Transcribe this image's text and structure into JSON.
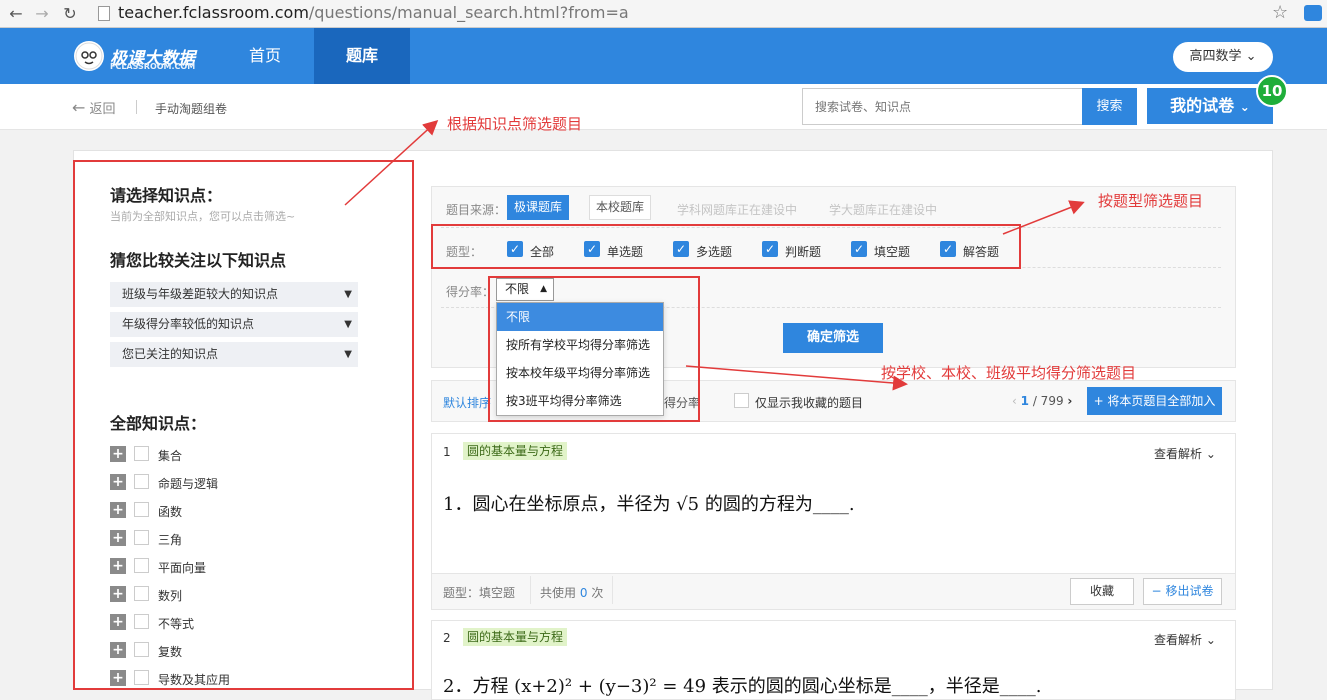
{
  "browser": {
    "url_host": "teacher.fclassroom.com",
    "url_path": "/questions/manual_search.html?from=a"
  },
  "header": {
    "logo_text": "极课大数据",
    "logo_sub": "FCLASSROOM.COM",
    "nav": [
      "首页",
      "题库"
    ],
    "subject": "高四数学"
  },
  "subbar": {
    "back": "返回",
    "crumb": "手动淘题组卷",
    "search_placeholder": "搜索试卷、知识点",
    "search_btn": "搜索",
    "paper_btn": "我的试卷",
    "paper_count": "10"
  },
  "left": {
    "title": "请选择知识点：",
    "hint": "当前为全部知识点，您可以点击筛选~",
    "guess_title": "猜您比较关注以下知识点",
    "selects": [
      "班级与年级差距较大的知识点",
      "年级得分率较低的知识点",
      "您已关注的知识点"
    ],
    "all_title": "全部知识点：",
    "tree": [
      "集合",
      "命题与逻辑",
      "函数",
      "三角",
      "平面向量",
      "数列",
      "不等式",
      "复数",
      "导数及其应用"
    ]
  },
  "filter": {
    "source_label": "题目来源：",
    "sources": [
      "极课题库",
      "本校题库"
    ],
    "sources_building": [
      "学科网题库正在建设中",
      "学大题库正在建设中"
    ],
    "type_label": "题型：",
    "types": [
      "全部",
      "单选题",
      "多选题",
      "判断题",
      "填空题",
      "解答题"
    ],
    "rate_label": "得分率：",
    "rate_value": "不限",
    "rate_options": [
      "不限",
      "按所有学校平均得分率筛选",
      "按本校年级平均得分率筛选",
      "按3班平均得分率筛选"
    ],
    "confirm": "确定筛选"
  },
  "sort": {
    "default": "默认排序",
    "rate": "得分率",
    "fav_only": "仅显示我收藏的题目",
    "page_current": "1",
    "page_total": "/ 799",
    "add_all": "+ 将本页题目全部加入"
  },
  "questions": [
    {
      "num": "1",
      "tag": "圆的基本量与方程",
      "view": "查看解析",
      "text": "1．圆心在坐标原点，半径为 √5 的圆的方程为____.",
      "type_text": "题型：填空题",
      "used_prefix": "共使用",
      "used_count": "0",
      "used_suffix": "次",
      "fav": "收藏",
      "remove": "移出试卷"
    },
    {
      "num": "2",
      "tag": "圆的基本量与方程",
      "view": "查看解析",
      "text": "2．方程 (x+2)² + (y−3)² = 49 表示的圆的圆心坐标是____，半径是____."
    }
  ],
  "annotations": [
    "根据知识点筛选题目",
    "按题型筛选题目",
    "按学校、本校、班级平均得分筛选题目"
  ],
  "colors": {
    "brand": "#2f86de",
    "annotation": "#e23b3b",
    "badge": "#1fae3a"
  }
}
